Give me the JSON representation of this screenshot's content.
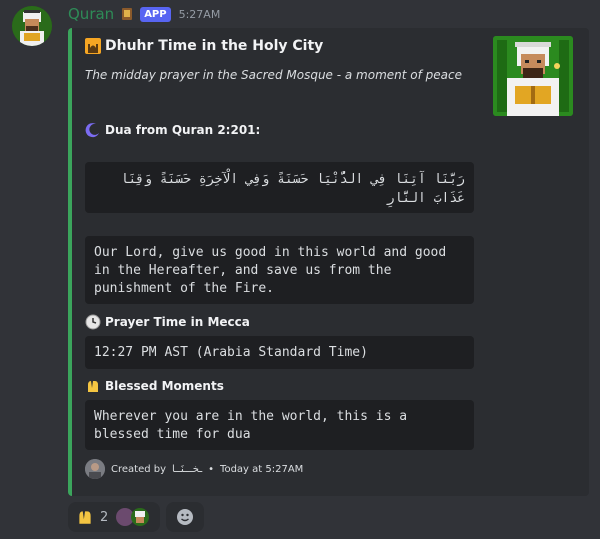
{
  "message": {
    "username": "Quran",
    "app_tag": "APP",
    "timestamp": "5:27AM"
  },
  "embed": {
    "title": "Dhuhr Time in the Holy City",
    "description": "The midday prayer in the Sacred Mosque - a moment of peace",
    "accent_color": "#3ba55c",
    "fields": [
      {
        "name": "Dua from Quran 2:201:",
        "icon": "crescent-icon",
        "value": "رَبَّنَا آتِنَا فِي الدُّنْيَا حَسَنَةً وَفِي الْآخِرَةِ حَسَنَةً وَقِنَا عَذَابَ النَّارِ"
      },
      {
        "name": "",
        "value": "Our Lord, give us good in this world and good in the Hereafter, and save us from the punishment of the Fire."
      },
      {
        "name": "Prayer Time in Mecca",
        "icon": "clock-icon",
        "value": "12:27 PM AST (Arabia Standard Time)"
      },
      {
        "name": "Blessed Moments",
        "icon": "praying-hands-icon",
        "value": "Wherever you are in the world, this is a blessed time for dua"
      }
    ],
    "footer": {
      "created_by": "Created by",
      "author": "ـخـــنَــا",
      "separator": "•",
      "time": "Today at 5:27AM"
    }
  },
  "reactions": [
    {
      "icon": "praying-hands-icon",
      "count": "2"
    }
  ]
}
